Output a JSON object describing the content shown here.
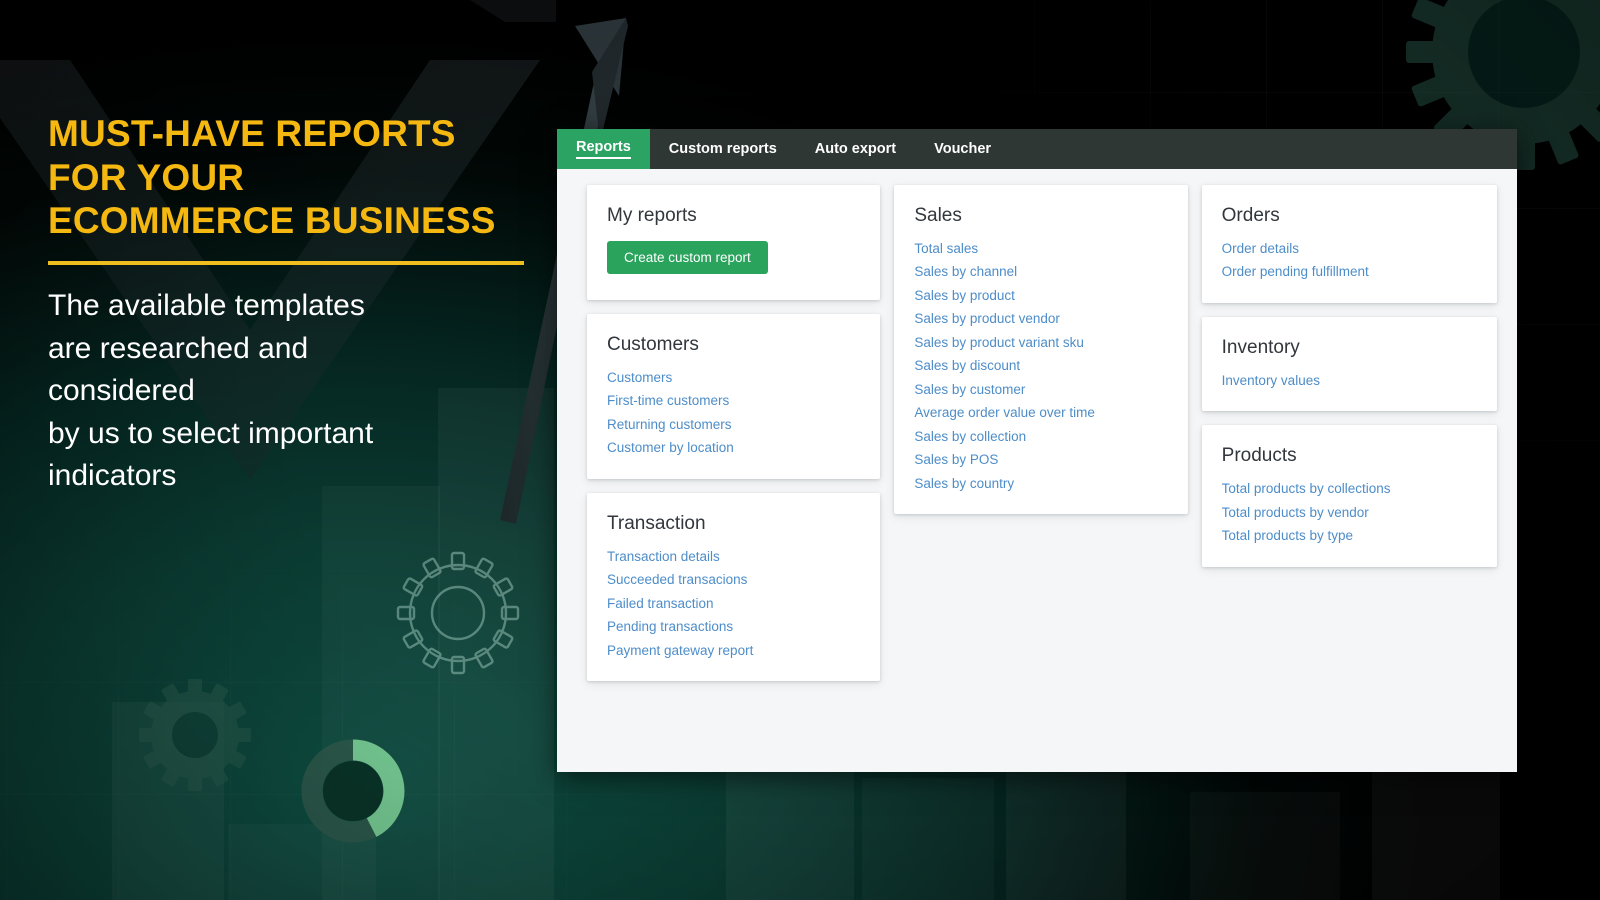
{
  "promo": {
    "headline_lines": [
      "MUST-HAVE REPORTS",
      "FOR YOUR",
      "ECOMMERCE BUSINESS"
    ],
    "subcopy_lines": [
      "The available templates",
      "are researched and",
      "considered",
      "by us to select important",
      "indicators"
    ],
    "headline_color": "#f5b811",
    "rule_color": "#f0bf1f",
    "subcopy_color": "#ffffff"
  },
  "app": {
    "accent_green": "#2aa35c",
    "tabbar_bg": "#2e3733",
    "panel_bg": "#f4f6f8",
    "link_color": "#4d8dc9",
    "tabs": [
      {
        "label": "Reports",
        "active": true
      },
      {
        "label": "Custom reports",
        "active": false
      },
      {
        "label": "Auto export",
        "active": false
      },
      {
        "label": "Voucher",
        "active": false
      }
    ],
    "cards": {
      "my_reports": {
        "title": "My reports",
        "button_label": "Create custom report"
      },
      "customers": {
        "title": "Customers",
        "links": [
          "Customers",
          "First-time customers",
          "Returning customers",
          "Customer by location"
        ]
      },
      "transaction": {
        "title": "Transaction",
        "links": [
          "Transaction details",
          "Succeeded transacions",
          "Failed transaction",
          "Pending transactions",
          "Payment gateway report"
        ]
      },
      "sales": {
        "title": "Sales",
        "links": [
          "Total sales",
          "Sales by channel",
          "Sales by product",
          "Sales by product vendor",
          "Sales by product variant sku",
          "Sales by discount",
          "Sales by customer",
          "Average order value over time",
          "Sales by collection",
          "Sales by POS",
          "Sales by country"
        ]
      },
      "orders": {
        "title": "Orders",
        "links": [
          "Order details",
          "Order pending fulfillment"
        ]
      },
      "inventory": {
        "title": "Inventory",
        "links": [
          "Inventory values"
        ]
      },
      "products": {
        "title": "Products",
        "links": [
          "Total products by collections",
          "Total products by vendor",
          "Total products by type"
        ]
      }
    }
  },
  "decor": {
    "donut_segment_color": "#7fd69b",
    "donut_track_color": "#2d5a4d",
    "gear_color": "#2a5a4d",
    "arrow_color": "#2b3438"
  }
}
